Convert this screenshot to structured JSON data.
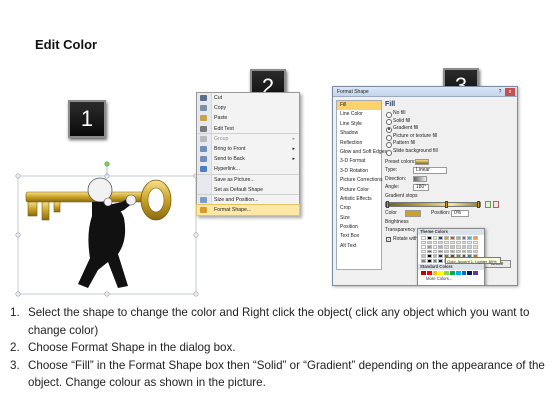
{
  "title": "Edit Color",
  "step_badges": [
    "1",
    "2",
    "3"
  ],
  "context_menu": {
    "items": [
      {
        "label": "Cut",
        "icon": "scissors-icon",
        "color": "#5b6f8c",
        "disabled": false,
        "submenu": false
      },
      {
        "label": "Copy",
        "icon": "copy-icon",
        "color": "#7d8ea8",
        "disabled": false,
        "submenu": false
      },
      {
        "label": "Paste",
        "icon": "paste-icon",
        "color": "#c9a24a",
        "disabled": false,
        "submenu": false
      },
      {
        "label": "Edit Text",
        "icon": "text-icon",
        "color": "#7a7a7a",
        "disabled": false,
        "submenu": false
      },
      {
        "label": "Group",
        "icon": "group-icon",
        "color": "#b8b8b8",
        "disabled": true,
        "submenu": true
      },
      {
        "label": "Bring to Front",
        "icon": "bring-front-icon",
        "color": "#6f8fb8",
        "disabled": false,
        "submenu": true
      },
      {
        "label": "Send to Back",
        "icon": "send-back-icon",
        "color": "#6f8fb8",
        "disabled": false,
        "submenu": true
      },
      {
        "label": "Hyperlink...",
        "icon": "hyperlink-icon",
        "color": "#4a7fc1",
        "disabled": false,
        "submenu": false
      },
      {
        "label": "Save as Picture...",
        "icon": "",
        "color": "",
        "disabled": false,
        "submenu": false
      },
      {
        "label": "Set as Default Shape",
        "icon": "",
        "color": "",
        "disabled": false,
        "submenu": false
      },
      {
        "label": "Size and Position...",
        "icon": "size-icon",
        "color": "#7b9cc6",
        "disabled": false,
        "submenu": false
      },
      {
        "label": "Format Shape...",
        "icon": "format-shape-icon",
        "color": "#d59c2b",
        "disabled": false,
        "submenu": false
      }
    ]
  },
  "dialog": {
    "title": "Format Shape",
    "help": "?",
    "close": "x",
    "nav": [
      "Fill",
      "Line Color",
      "Line Style",
      "Shadow",
      "Reflection",
      "Glow and Soft Edges",
      "3-D Format",
      "3-D Rotation",
      "Picture Corrections",
      "Picture Color",
      "Artistic Effects",
      "Crop",
      "Size",
      "Position",
      "Text Box",
      "Alt Text"
    ],
    "selected_nav": "Fill",
    "fill_heading": "Fill",
    "fill_options": [
      "No fill",
      "Solid fill",
      "Gradient fill",
      "Picture or texture fill",
      "Pattern fill",
      "Slide background fill"
    ],
    "selected_fill": "Gradient fill",
    "preset_label": "Preset colors:",
    "type_label": "Type:",
    "type_value": "Linear",
    "direction_label": "Direction:",
    "angle_label": "Angle:",
    "angle_value": "180°",
    "stops_label": "Gradient stops",
    "color_label": "Color",
    "position_label": "Position:",
    "position_value": "0%",
    "brightness_label": "Brightness",
    "transparency_label": "Transparency",
    "rotate_label": "Rotate with shape",
    "add_label": "Add",
    "remove_label": "Remove",
    "close_button": "Close"
  },
  "color_picker": {
    "theme_heading": "Theme Colors",
    "standard_heading": "Standard Colors",
    "more_label": "More Colors...",
    "tooltip": "Gold, Accent 1, Lighter 80%",
    "theme_base": [
      "#ffffff",
      "#000000",
      "#eeece1",
      "#1f497d",
      "#c9a227",
      "#c0504d",
      "#9bbb59",
      "#8064a2",
      "#4bacc6",
      "#f79646"
    ],
    "standard": [
      "#c00000",
      "#ff0000",
      "#ffc000",
      "#ffff00",
      "#92d050",
      "#00b050",
      "#00b0f0",
      "#0070c0",
      "#002060",
      "#7030a0"
    ]
  },
  "instructions": [
    {
      "num": "1.",
      "text": "Select the shape to change the color and Right click the object( click any object which you want to change color)"
    },
    {
      "num": "2.",
      "text": "Choose Format Shape in the dialog box."
    },
    {
      "num": "3.",
      "text": "Choose “Fill” in the Format Shape box then “Solid” or “Gradient” depending on the appearance of the object. Change colour as shown in the picture."
    }
  ]
}
